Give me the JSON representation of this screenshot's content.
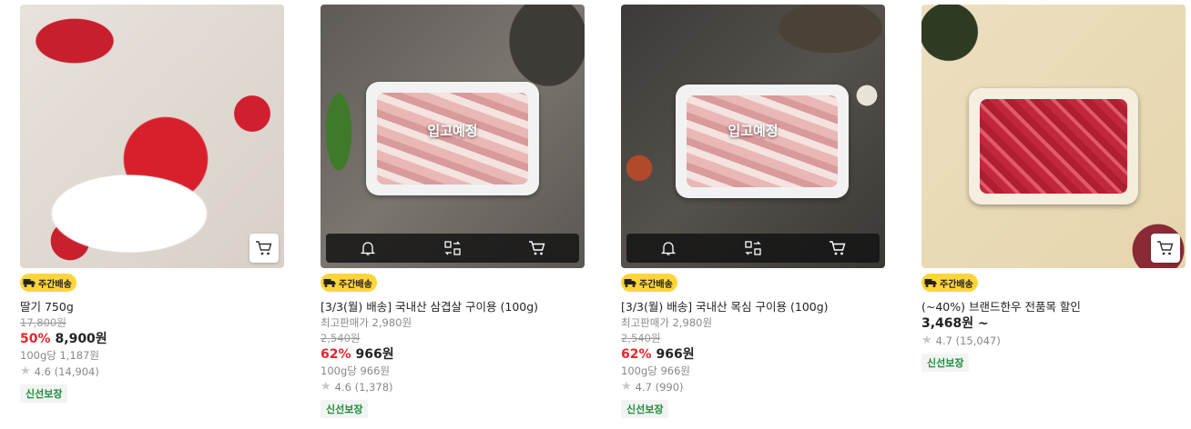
{
  "products": [
    {
      "badge": "주간배송",
      "name": "딸기 750g",
      "original_price": "17,800원",
      "discount_pct": "50%",
      "price": "8,900원",
      "unit_price": "100g당 1,187원",
      "rating": "4.6 (14,904)",
      "tag": "신선보장"
    },
    {
      "overlay": "입고예정",
      "badge": "주간배송",
      "name": "[3/3(월) 배송] 국내산 삼겹살 구이용 (100g)",
      "top_price": "최고판매가 2,980원",
      "original_price": "2,540원",
      "discount_pct": "62%",
      "price": "966원",
      "unit_price": "100g당 966원",
      "rating": "4.6 (1,378)",
      "tag": "신선보장"
    },
    {
      "overlay": "입고예정",
      "badge": "주간배송",
      "name": "[3/3(월) 배송] 국내산 목심 구이용 (100g)",
      "top_price": "최고판매가 2,980원",
      "original_price": "2,540원",
      "discount_pct": "62%",
      "price": "966원",
      "unit_price": "100g당 966원",
      "rating": "4.7 (990)",
      "tag": "신선보장"
    },
    {
      "badge": "주간배송",
      "name": "(~40%) 브랜드한우 전품목 할인",
      "price": "3,468원 ~",
      "rating": "4.7 (15,047)",
      "tag": "신선보장"
    }
  ],
  "icons": {
    "cart": "cart-icon",
    "bell": "bell-icon",
    "compare": "compare-icon",
    "delivery": "truck-icon",
    "star": "star-icon"
  },
  "colors": {
    "discount": "#e8242a",
    "badge_bg": "#ffd43a",
    "fresh_text": "#1e8a3c"
  }
}
